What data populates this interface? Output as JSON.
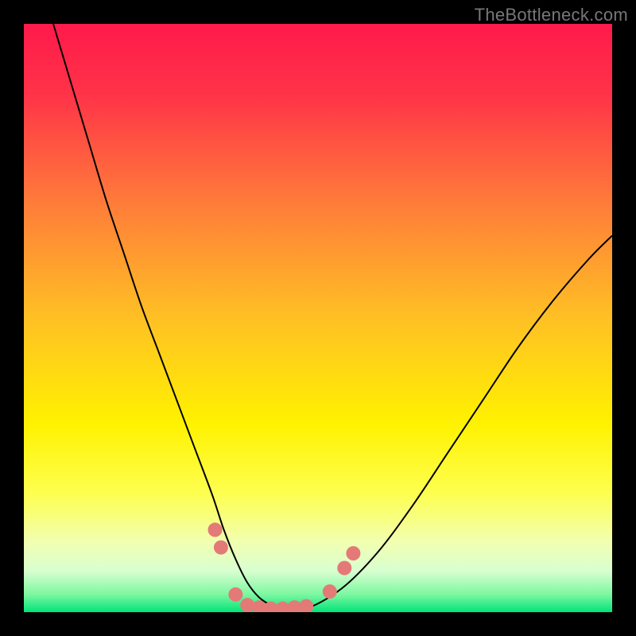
{
  "watermark": "TheBottleneck.com",
  "chart_data": {
    "type": "line",
    "title": "",
    "xlabel": "",
    "ylabel": "",
    "xlim": [
      0,
      100
    ],
    "ylim": [
      0,
      100
    ],
    "background_gradient": {
      "stops": [
        {
          "offset": 0.0,
          "color": "#ff1a4b"
        },
        {
          "offset": 0.12,
          "color": "#ff3348"
        },
        {
          "offset": 0.3,
          "color": "#ff7a3a"
        },
        {
          "offset": 0.5,
          "color": "#ffc024"
        },
        {
          "offset": 0.68,
          "color": "#fff200"
        },
        {
          "offset": 0.8,
          "color": "#fdff51"
        },
        {
          "offset": 0.88,
          "color": "#f2ffb0"
        },
        {
          "offset": 0.93,
          "color": "#d8ffd0"
        },
        {
          "offset": 0.97,
          "color": "#7cf7a0"
        },
        {
          "offset": 1.0,
          "color": "#00e47a"
        }
      ]
    },
    "series": [
      {
        "name": "bottleneck-curve",
        "color": "#000000",
        "width": 2,
        "x": [
          5,
          8,
          11,
          14,
          17,
          20,
          23,
          26,
          29,
          32,
          34,
          36,
          38,
          40,
          42,
          44,
          48,
          54,
          60,
          66,
          72,
          78,
          84,
          90,
          96,
          100
        ],
        "y": [
          100,
          90,
          80,
          70,
          61,
          52,
          44,
          36,
          28,
          20,
          14,
          9,
          5,
          2.5,
          1.2,
          0.6,
          0.6,
          4,
          10,
          18,
          27,
          36,
          45,
          53,
          60,
          64
        ]
      }
    ],
    "marker_points": {
      "name": "highlight-dots",
      "color": "#e47a78",
      "radius": 9,
      "points": [
        {
          "x": 32.5,
          "y": 14
        },
        {
          "x": 33.5,
          "y": 11
        },
        {
          "x": 36.0,
          "y": 3.0
        },
        {
          "x": 38.0,
          "y": 1.2
        },
        {
          "x": 40.0,
          "y": 0.8
        },
        {
          "x": 42.0,
          "y": 0.6
        },
        {
          "x": 44.0,
          "y": 0.6
        },
        {
          "x": 46.0,
          "y": 0.8
        },
        {
          "x": 48.0,
          "y": 1.0
        },
        {
          "x": 52.0,
          "y": 3.5
        },
        {
          "x": 54.5,
          "y": 7.5
        },
        {
          "x": 56.0,
          "y": 10.0
        }
      ]
    }
  }
}
